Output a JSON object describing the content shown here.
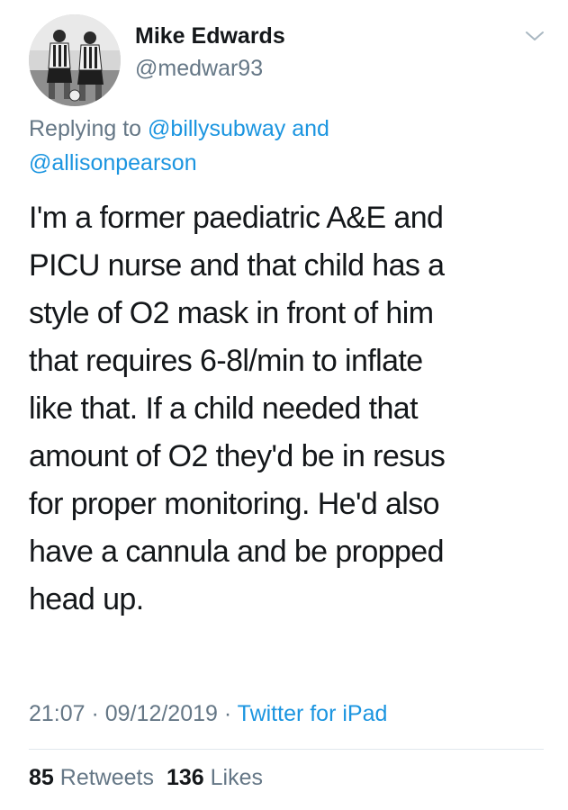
{
  "author": {
    "display_name": "Mike Edwards",
    "handle": "@medwar93",
    "avatar_icon": "profile-photo-two-footballers"
  },
  "reply_context": {
    "prefix": "Replying to ",
    "mention_1": "@billysubway",
    "conjunction": " and",
    "mention_2": "@allisonpearson"
  },
  "tweet": {
    "lines": [
      "I'm a former paediatric A&E and",
      "PICU nurse and that child has a",
      "style of O2 mask in front of him",
      "that requires 6-8l/min to inflate",
      "like that. If a child needed that",
      "amount of O2 they'd be in resus",
      "for proper monitoring. He'd also",
      "have a cannula and be propped",
      "head up."
    ]
  },
  "meta": {
    "time": "21:07",
    "separator": " · ",
    "date": "09/12/2019",
    "source": "Twitter for iPad"
  },
  "stats": {
    "retweets_count": "85",
    "retweets_label": "Retweets",
    "likes_count": "136",
    "likes_label": "Likes"
  },
  "colors": {
    "text": "#14171a",
    "secondary": "#657786",
    "link": "#1b95e0",
    "divider": "#e1e8ed"
  }
}
